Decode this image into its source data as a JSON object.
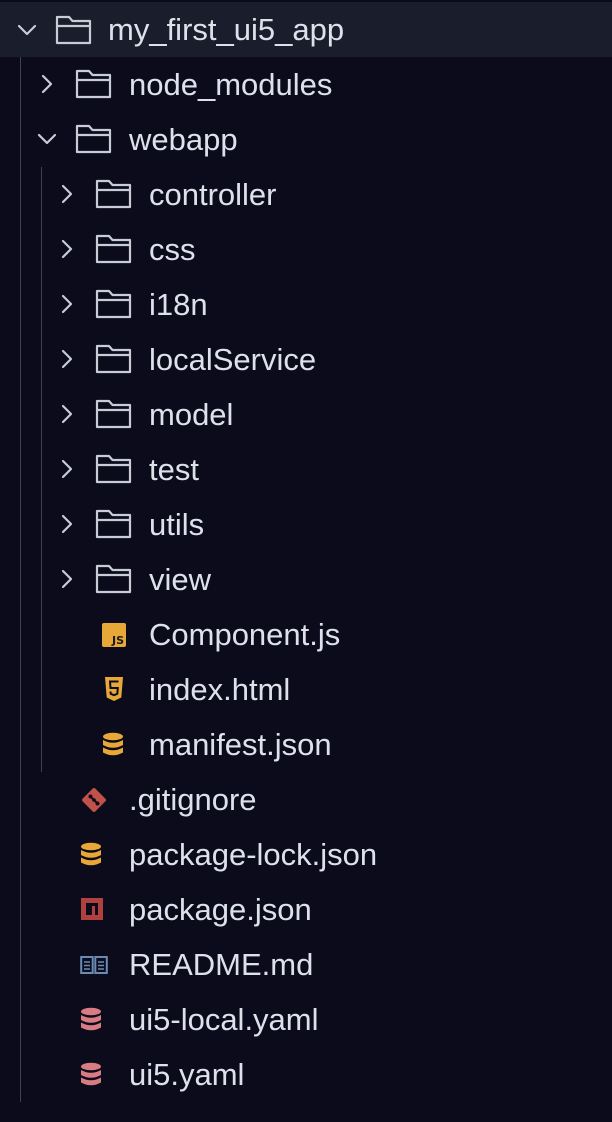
{
  "explorer": {
    "root": {
      "label": "my_first_ui5_app",
      "expanded": true,
      "icon": "folder-icon"
    },
    "items": [
      {
        "label": "node_modules",
        "type": "folder",
        "expanded": false,
        "icon": "folder-icon"
      },
      {
        "label": "webapp",
        "type": "folder",
        "expanded": true,
        "icon": "folder-icon"
      },
      {
        "label": "controller",
        "type": "folder",
        "expanded": false,
        "icon": "folder-icon"
      },
      {
        "label": "css",
        "type": "folder",
        "expanded": false,
        "icon": "folder-icon"
      },
      {
        "label": "i18n",
        "type": "folder",
        "expanded": false,
        "icon": "folder-icon"
      },
      {
        "label": "localService",
        "type": "folder",
        "expanded": false,
        "icon": "folder-icon"
      },
      {
        "label": "model",
        "type": "folder",
        "expanded": false,
        "icon": "folder-icon"
      },
      {
        "label": "test",
        "type": "folder",
        "expanded": false,
        "icon": "folder-icon"
      },
      {
        "label": "utils",
        "type": "folder",
        "expanded": false,
        "icon": "folder-icon"
      },
      {
        "label": "view",
        "type": "folder",
        "expanded": false,
        "icon": "folder-icon"
      },
      {
        "label": "Component.js",
        "type": "file",
        "icon": "javascript-icon",
        "badge": "JS"
      },
      {
        "label": "index.html",
        "type": "file",
        "icon": "html5-icon"
      },
      {
        "label": "manifest.json",
        "type": "file",
        "icon": "database-icon"
      },
      {
        "label": ".gitignore",
        "type": "file",
        "icon": "git-icon"
      },
      {
        "label": "package-lock.json",
        "type": "file",
        "icon": "database-icon"
      },
      {
        "label": "package.json",
        "type": "file",
        "icon": "npm-icon"
      },
      {
        "label": "README.md",
        "type": "file",
        "icon": "book-icon"
      },
      {
        "label": "ui5-local.yaml",
        "type": "file",
        "icon": "database-icon"
      },
      {
        "label": "ui5.yaml",
        "type": "file",
        "icon": "database-icon"
      }
    ]
  },
  "colors": {
    "background": "#0b0b1c",
    "selected_row": "#1a1d2b",
    "text": "#dde2ea",
    "icon_outline": "#c8ccd5",
    "guide": "#3e4353",
    "javascript": "#e8a838",
    "html5": "#e8a838",
    "json_database": "#e8a838",
    "git": "#c0524a",
    "npm": "#b0413e",
    "readme": "#6b8bb5",
    "yaml_database": "#d87b82"
  }
}
